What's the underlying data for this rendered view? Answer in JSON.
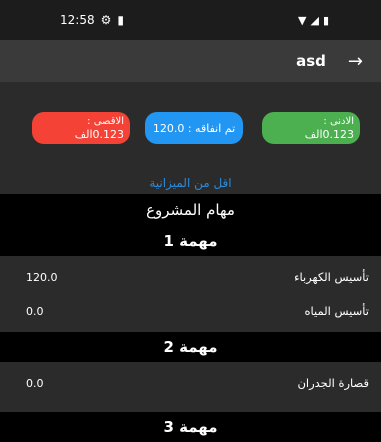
{
  "status_bar": {
    "time": "12:58"
  },
  "app_bar": {
    "title": "asd",
    "back_icon": "→"
  },
  "budget": {
    "min_label": "الادنى :",
    "min_value": "0.123الف",
    "spent_label": "تم انفاقه : 120.0",
    "max_label": "الاقصى :",
    "max_value": "0.123الف",
    "status_text": "اقل من الميزانية"
  },
  "tasks_section": {
    "title": "مهام المشروع",
    "tasks": [
      {
        "header": "مهمة 1",
        "items": [
          {
            "name": "تأسيس الكهرباء",
            "value": "120.0"
          },
          {
            "name": "تأسيس المياه",
            "value": "0.0"
          }
        ]
      },
      {
        "header": "مهمة 2",
        "items": [
          {
            "name": "قصارة الجدران",
            "value": "0.0"
          }
        ]
      },
      {
        "header": "مهمة 3",
        "items": []
      }
    ]
  }
}
